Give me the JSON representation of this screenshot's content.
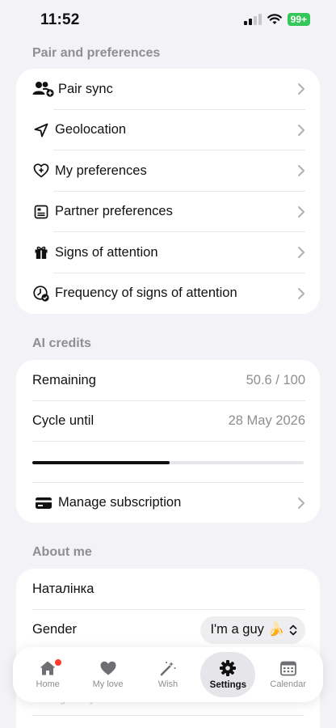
{
  "status_bar": {
    "time": "11:52",
    "battery": "99+"
  },
  "sections": {
    "pair": {
      "header": "Pair and preferences",
      "items": [
        {
          "label": "Pair sync",
          "icon": "people-add-icon"
        },
        {
          "label": "Geolocation",
          "icon": "location-arrow-icon"
        },
        {
          "label": "My preferences",
          "icon": "heart-plus-icon"
        },
        {
          "label": "Partner preferences",
          "icon": "id-card-icon"
        },
        {
          "label": "Signs of attention",
          "icon": "gift-icon"
        },
        {
          "label": "Frequency of signs of attention",
          "icon": "clock-check-icon"
        }
      ]
    },
    "ai_credits": {
      "header": "AI credits",
      "remaining_label": "Remaining",
      "remaining_value": "50.6 / 100",
      "cycle_label": "Cycle until",
      "cycle_value": "28 May 2026",
      "progress_fraction": 0.506,
      "manage_label": "Manage subscription"
    },
    "about": {
      "header": "About me",
      "name": "Наталінка",
      "gender_label": "Gender",
      "gender_value": "I'm a guy 🍌",
      "age_text": "Your age: 37 years"
    }
  },
  "tabbar": {
    "active": "Settings",
    "tabs": [
      {
        "label": "Home",
        "icon": "home-icon",
        "badge": true
      },
      {
        "label": "My love",
        "icon": "heart-icon"
      },
      {
        "label": "Wish",
        "icon": "magic-wand-icon"
      },
      {
        "label": "Settings",
        "icon": "gear-icon"
      },
      {
        "label": "Calendar",
        "icon": "calendar-icon"
      }
    ]
  },
  "colors": {
    "accent_green": "#34c759",
    "badge_red": "#ff3b30",
    "background": "#f2f2f7",
    "muted": "#8e8e93"
  }
}
